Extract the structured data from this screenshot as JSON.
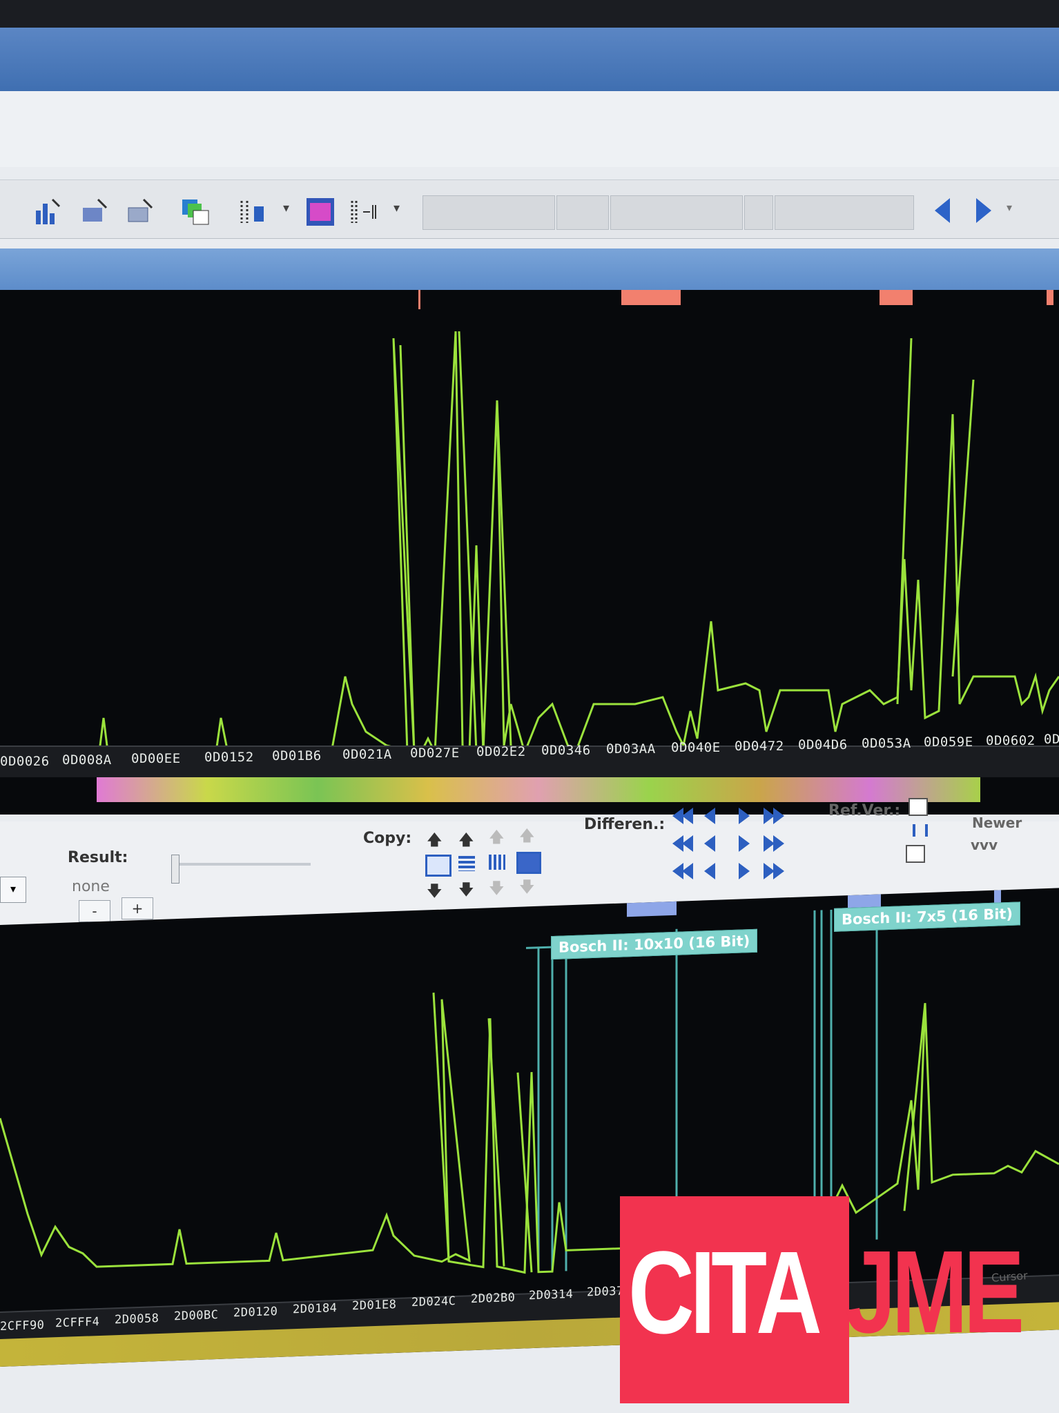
{
  "toolbar": {
    "icons": [
      "bar-chart-icon",
      "scatter-icon",
      "3d-graph-icon",
      "copy-green-icon",
      "columns-icon",
      "window-icon",
      "split-icon"
    ],
    "nav_left": "prev-arrow-icon",
    "nav_right": "next-arrow-icon"
  },
  "top_graph": {
    "addresses": [
      "0D0026",
      "0D008A",
      "0D00EE",
      "0D0152",
      "0D01B6",
      "0D021A",
      "0D027E",
      "0D02E2",
      "0D0346",
      "0D03AA",
      "0D040E",
      "0D0472",
      "0D04D6",
      "0D053A",
      "0D059E",
      "0D0602",
      "0D"
    ]
  },
  "controls": {
    "result_label": "Result:",
    "result_value": "none",
    "minus": "-",
    "plus": "+",
    "copy_label": "Copy:",
    "differen_label": "Differen.:",
    "refver_label": "Ref.Ver.:",
    "newer_label": "Newer",
    "vvv_label": "vvv"
  },
  "bottom_graph": {
    "star": "*",
    "map1_label": "Bosch II: 10x10 (16 Bit)",
    "map2_label": "Bosch II: 7x5 (16 Bit)",
    "addresses": [
      "2CFF90",
      "2CFFF4",
      "2D0058",
      "2D00BC",
      "2D0120",
      "2D0184",
      "2D01E8",
      "2D024C",
      "2D02B0",
      "2D0314",
      "2D037"
    ],
    "cursor_text": "Cursor"
  },
  "watermark": {
    "text_left": "CITA",
    "text_right": "JME",
    "colors": {
      "red": "#f2334f",
      "white": "#ffffff"
    }
  }
}
